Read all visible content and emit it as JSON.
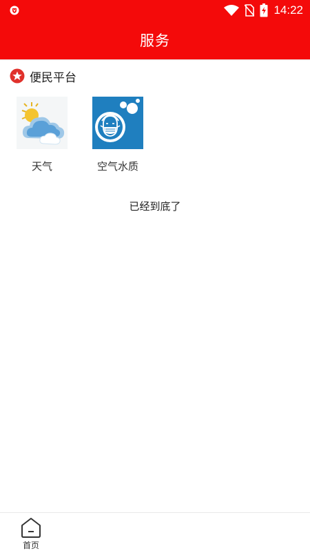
{
  "status_bar": {
    "time": "14:22",
    "icons": [
      "shield-app-icon",
      "wifi-icon",
      "no-sim-icon",
      "battery-charging-icon"
    ]
  },
  "header": {
    "title": "服务"
  },
  "section": {
    "title": "便民平台",
    "icon": "star-badge-icon",
    "items": [
      {
        "label": "天气",
        "icon": "weather-cloud-sun-icon"
      },
      {
        "label": "空气水质",
        "icon": "face-mask-icon"
      }
    ]
  },
  "list_end_text": "已经到底了",
  "tab_bar": {
    "items": [
      {
        "label": "首页",
        "icon": "home-icon"
      }
    ]
  },
  "colors": {
    "brand_red": "#f40a0a",
    "mask_tile_blue": "#1f7fbf"
  }
}
